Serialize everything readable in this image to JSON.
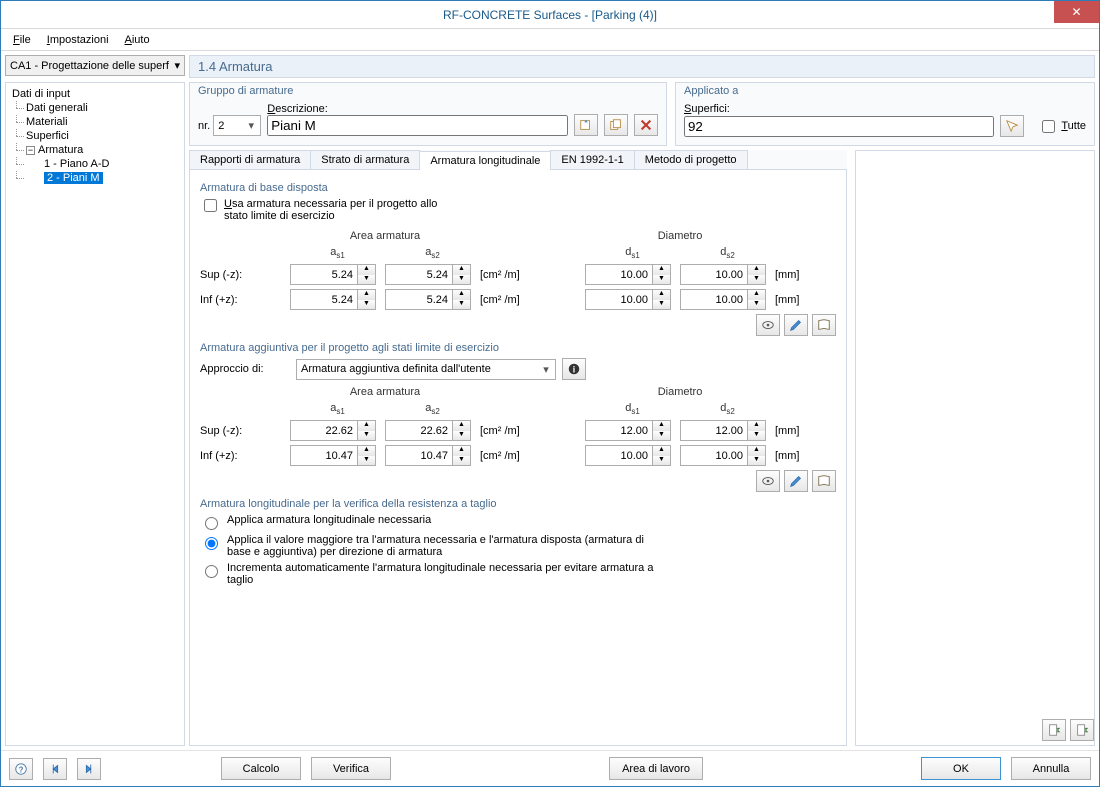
{
  "window": {
    "title": "RF-CONCRETE Surfaces - [Parking (4)]"
  },
  "menubar": {
    "file": "File",
    "settings": "Impostazioni",
    "help": "Aiuto"
  },
  "case_selector": "CA1 - Progettazione delle superf",
  "section_heading": "1.4 Armatura",
  "tree": {
    "root": "Dati di input",
    "items": [
      "Dati generali",
      "Materiali",
      "Superfici"
    ],
    "arm_root": "Armatura",
    "arm_items": [
      "1 - Piano A-D",
      "2 - Piani M"
    ],
    "selected": "2 - Piani M"
  },
  "group_arm": {
    "title": "Gruppo di armature",
    "nr_label": "nr.",
    "nr_value": "2",
    "desc_label": "Descrizione:",
    "desc_value": "Piani M"
  },
  "group_apply": {
    "title": "Applicato a",
    "surf_label": "Superfici:",
    "surf_value": "92",
    "all_label": "Tutte"
  },
  "tabs": [
    "Rapporti di armatura",
    "Strato di armatura",
    "Armatura longitudinale",
    "EN 1992-1-1",
    "Metodo di progetto"
  ],
  "active_tab": 2,
  "sec_base": {
    "title": "Armatura di base disposta",
    "chk_label": "Usa armatura necessaria per il progetto allo stato limite di esercizio",
    "area_hdr": "Area armatura",
    "diam_hdr": "Diametro",
    "as1": "as1",
    "as2": "as2",
    "ds1": "ds1",
    "ds2": "ds2",
    "sup_label": "Sup (-z):",
    "inf_label": "Inf (+z):",
    "unit_area": "[cm² /m]",
    "unit_mm": "[mm]",
    "sup": {
      "a1": "5.24",
      "a2": "5.24",
      "d1": "10.00",
      "d2": "10.00"
    },
    "inf": {
      "a1": "5.24",
      "a2": "5.24",
      "d1": "10.00",
      "d2": "10.00"
    }
  },
  "sec_add": {
    "title": "Armatura aggiuntiva per il progetto agli stati limite di esercizio",
    "approach_label": "Approccio di:",
    "approach_value": "Armatura aggiuntiva definita dall'utente",
    "sup": {
      "a1": "22.62",
      "a2": "22.62",
      "d1": "12.00",
      "d2": "12.00"
    },
    "inf": {
      "a1": "10.47",
      "a2": "10.47",
      "d1": "10.00",
      "d2": "10.00"
    }
  },
  "sec_shear": {
    "title": "Armatura longitudinale per la verifica della resistenza a taglio",
    "opt1": "Applica armatura longitudinale necessaria",
    "opt2": "Applica il valore maggiore tra l'armatura necessaria e l'armatura disposta (armatura di base e aggiuntiva) per direzione di armatura",
    "opt3": "Incrementa automaticamente l'armatura longitudinale necessaria per evitare armatura a taglio"
  },
  "footer": {
    "calc": "Calcolo",
    "verify": "Verifica",
    "workarea": "Area di lavoro",
    "ok": "OK",
    "cancel": "Annulla"
  }
}
